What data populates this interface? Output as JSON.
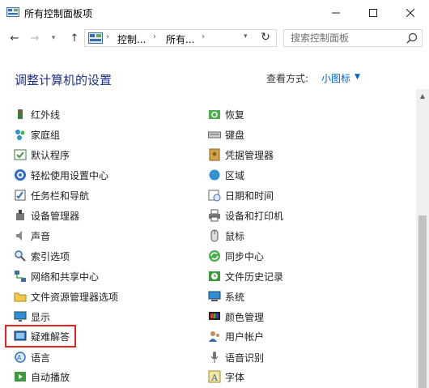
{
  "window": {
    "title": "所有控制面板项",
    "minimize_glyph": "—",
    "maximize_glyph": "☐",
    "close_glyph": "✕"
  },
  "nav": {
    "back_glyph": "←",
    "forward_glyph": "→",
    "recent_glyph": "▾",
    "up_glyph": "↑",
    "breadcrumbs": [
      "控制...",
      "所有..."
    ],
    "sep_glyph": "›",
    "dropdown_glyph": "▾",
    "refresh_glyph": "↻"
  },
  "search": {
    "placeholder": "搜索控制面板"
  },
  "header": {
    "title": "调整计算机的设置",
    "view_by_label": "查看方式:",
    "view_by_value": "小图标",
    "view_by_arrow": "▼"
  },
  "items_left": [
    {
      "label": "红外线",
      "icon": "infrared-icon"
    },
    {
      "label": "家庭组",
      "icon": "homegroup-icon"
    },
    {
      "label": "默认程序",
      "icon": "default-programs-icon"
    },
    {
      "label": "轻松使用设置中心",
      "icon": "ease-of-access-icon"
    },
    {
      "label": "任务栏和导航",
      "icon": "taskbar-icon"
    },
    {
      "label": "设备管理器",
      "icon": "device-manager-icon"
    },
    {
      "label": "声音",
      "icon": "sound-icon"
    },
    {
      "label": "索引选项",
      "icon": "indexing-icon"
    },
    {
      "label": "网络和共享中心",
      "icon": "network-icon"
    },
    {
      "label": "文件资源管理器选项",
      "icon": "folder-options-icon"
    },
    {
      "label": "显示",
      "icon": "display-icon"
    },
    {
      "label": "疑难解答",
      "icon": "troubleshooting-icon"
    },
    {
      "label": "语言",
      "icon": "language-icon"
    },
    {
      "label": "自动播放",
      "icon": "autoplay-icon"
    }
  ],
  "items_right": [
    {
      "label": "恢复",
      "icon": "recovery-icon"
    },
    {
      "label": "键盘",
      "icon": "keyboard-icon"
    },
    {
      "label": "凭据管理器",
      "icon": "credential-manager-icon"
    },
    {
      "label": "区域",
      "icon": "region-icon"
    },
    {
      "label": "日期和时间",
      "icon": "date-time-icon"
    },
    {
      "label": "设备和打印机",
      "icon": "printer-icon"
    },
    {
      "label": "鼠标",
      "icon": "mouse-icon"
    },
    {
      "label": "同步中心",
      "icon": "sync-center-icon"
    },
    {
      "label": "文件历史记录",
      "icon": "file-history-icon"
    },
    {
      "label": "系统",
      "icon": "system-icon"
    },
    {
      "label": "颜色管理",
      "icon": "color-management-icon"
    },
    {
      "label": "用户帐户",
      "icon": "user-accounts-icon"
    },
    {
      "label": "语音识别",
      "icon": "speech-icon"
    },
    {
      "label": "字体",
      "icon": "fonts-icon"
    }
  ],
  "highlighted_item": "疑难解答",
  "colors": {
    "title_blue": "#1e3287",
    "link_blue": "#0066cc",
    "highlight_red": "#e8221e"
  }
}
